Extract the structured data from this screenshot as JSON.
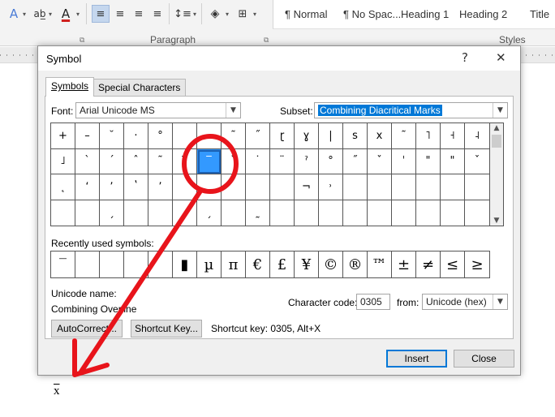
{
  "ribbon": {
    "paragraph_label": "Paragraph",
    "styles_label": "Styles",
    "styles": [
      "¶ Normal",
      "¶ No Spac...",
      "Heading 1",
      "Heading 2",
      "Title"
    ]
  },
  "document": {
    "text": "x"
  },
  "dialog": {
    "title": "Symbol",
    "help": "?",
    "close": "✕",
    "tabs": {
      "symbols": "Symbols",
      "special": "Special Characters"
    },
    "font_label": "Font:",
    "font_value": "Arial Unicode MS",
    "subset_label": "Subset:",
    "subset_value": "Combining Diacritical Marks",
    "symbols": [
      "+",
      "–",
      "˘",
      "·",
      "°",
      "",
      "",
      "˜",
      "˝",
      "ɽ",
      "ɣ",
      "|",
      "s",
      "x",
      "˜",
      "˥",
      "˧",
      "˨",
      "˩",
      "`",
      "ˊ",
      "ˆ",
      "˜",
      "‾",
      "‾",
      "˘",
      "˙",
      "¨",
      "ˀ",
      "°",
      "˝",
      "ˇ",
      "ˈ",
      "\"",
      "\"",
      "ˇ",
      "˛",
      "ʻ",
      "ʼ",
      "ʽ",
      "ʼ",
      "",
      "",
      "",
      "",
      "",
      "¬",
      "˒",
      "",
      "",
      "",
      "",
      "",
      "",
      "",
      "",
      "ˏ",
      "",
      "",
      "",
      "ˏ",
      "",
      "˷",
      "",
      "",
      "",
      "",
      "",
      "",
      "",
      "",
      ""
    ],
    "selected_index": 24,
    "recent_label": "Recently used symbols:",
    "recent": [
      "‾",
      "",
      "",
      "",
      "",
      "▮",
      "µ",
      "π",
      "€",
      "£",
      "¥",
      "©",
      "®",
      "™",
      "±",
      "≠",
      "≤",
      "≥"
    ],
    "unicode_name_label": "Unicode name:",
    "unicode_name_value": "Combining Overline",
    "char_code_label": "Character code:",
    "char_code_value": "0305",
    "from_label": "from:",
    "from_value": "Unicode (hex)",
    "autocorrect": "AutoCorrect...",
    "shortcut_key_btn": "Shortcut Key...",
    "shortcut_text": "Shortcut key: 0305, Alt+X",
    "insert": "Insert",
    "close_btn": "Close"
  },
  "colors": {
    "accent": "#0078d7",
    "annotation": "#e8141b",
    "selected_cell": "#3399ff"
  }
}
